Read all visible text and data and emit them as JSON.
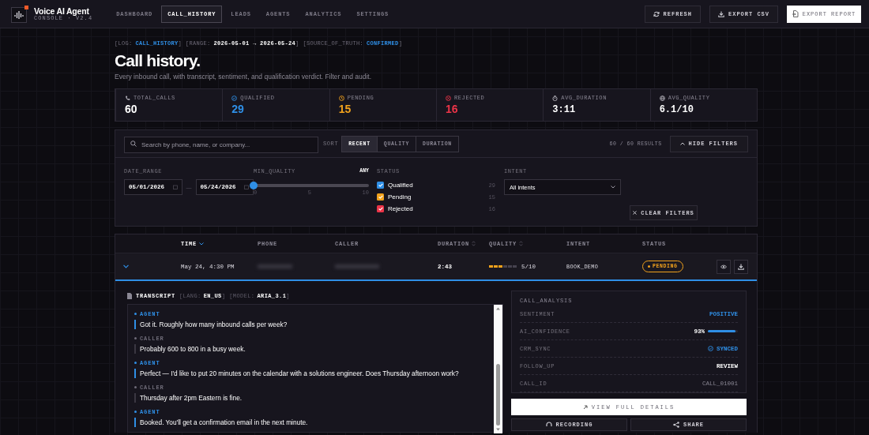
{
  "topbar": {
    "brand": "Voice AI Agent",
    "version": "CONSOLE · V2.4",
    "tabs": [
      {
        "label": "DASHBOARD",
        "selected": false
      },
      {
        "label": "CALL_HISTORY",
        "selected": true
      },
      {
        "label": "LEADS",
        "selected": false
      },
      {
        "label": "AGENTS",
        "selected": false
      },
      {
        "label": "ANALYTICS",
        "selected": false
      },
      {
        "label": "SETTINGS",
        "selected": false
      }
    ],
    "actions": [
      {
        "label": "REFRESH",
        "kind": "ghost"
      },
      {
        "label": "EXPORT CSV",
        "kind": "ghost"
      },
      {
        "label": "EXPORT REPORT",
        "kind": "primary"
      }
    ]
  },
  "header": {
    "meta": [
      {
        "open": "[LOG:",
        "value": "CALL_HISTORY",
        "close": "]",
        "kind": "accent"
      },
      {
        "open": "[RANGE:",
        "value": "2026-05-01 → 2026-05-24",
        "close": "]",
        "kind": "strong"
      },
      {
        "open": "[SOURCE_OF_TRUTH:",
        "value": "CONFIRMED",
        "close": "]",
        "kind": "accent"
      }
    ],
    "title": "Call history.",
    "subtitle": "Every inbound call, with transcript, sentiment, and qualification verdict. Filter and audit."
  },
  "stats": [
    {
      "label": "TOTAL_CALLS",
      "value": "60",
      "kind": "count",
      "color": "#ffffff"
    },
    {
      "label": "QUALIFIED",
      "value": "29",
      "kind": "count",
      "color": "#2f8fe6"
    },
    {
      "label": "PENDING",
      "value": "15",
      "kind": "count",
      "color": "#f2a21c"
    },
    {
      "label": "REJECTED",
      "value": "16",
      "kind": "count",
      "color": "#ec3448"
    },
    {
      "label": "AVG_DURATION",
      "value": "3:11",
      "kind": "metric",
      "color": "#ffffff"
    },
    {
      "label": "AVG_QUALITY",
      "value": "6.1/10",
      "kind": "metric",
      "color": "#ffffff"
    }
  ],
  "filters": {
    "search": {
      "placeholder": "Search by phone, name, or company..."
    },
    "sort_label": "SORT",
    "sort": [
      {
        "label": "RECENT",
        "selected": true
      },
      {
        "label": "QUALITY",
        "selected": false
      },
      {
        "label": "DURATION",
        "selected": false
      }
    ],
    "results": "60 / 60 RESULTS",
    "toggle": "HIDE FILTERS",
    "date_range": {
      "label": "DATE_RANGE",
      "from": "05/01/2026",
      "separator": "—",
      "to": "05/24/2026"
    },
    "min_quality": {
      "label": "MIN_QUALITY",
      "reading": "ANY",
      "level": 0,
      "ticks": [
        "0",
        "5",
        "10"
      ]
    },
    "status": {
      "label": "STATUS",
      "items": [
        {
          "label": "Qualified",
          "count": "29",
          "checked": true,
          "color": "#2f8fe6"
        },
        {
          "label": "Pending",
          "count": "15",
          "checked": true,
          "color": "#f2a21c"
        },
        {
          "label": "Rejected",
          "count": "16",
          "checked": true,
          "color": "#ec3448"
        }
      ]
    },
    "intent": {
      "label": "INTENT",
      "value": "All intents"
    },
    "clear": "CLEAR FILTERS"
  },
  "table": {
    "columns": [
      {
        "label": "TIME",
        "sorted": true
      },
      {
        "label": "PHONE",
        "sorted": false,
        "sortable": false
      },
      {
        "label": "CALLER",
        "sorted": false,
        "sortable": false
      },
      {
        "label": "DURATION",
        "sorted": false,
        "sortable": true
      },
      {
        "label": "QUALITY",
        "sorted": false,
        "sortable": true
      },
      {
        "label": "INTENT",
        "sorted": false,
        "sortable": false
      },
      {
        "label": "STATUS",
        "sorted": false,
        "sortable": false
      }
    ],
    "rows": [
      {
        "expanded": true,
        "time": "May 24, 4:30 PM",
        "redacted": true,
        "duration": "2:43",
        "quality": {
          "level": 0.5,
          "reading": "5/10"
        },
        "intent": "BOOK_DEMO",
        "status": {
          "label": "PENDING",
          "color": "#f2a21c"
        }
      }
    ]
  },
  "detail": {
    "transcript": {
      "title": "TRANSCRIPT",
      "meta": [
        {
          "open": "[LANG:",
          "value": "EN_US",
          "close": "]"
        },
        {
          "open": "[MODEL:",
          "value": "ARIA_3.1",
          "close": "]"
        }
      ],
      "messages": [
        {
          "speaker": "AGENT",
          "kind": "agent",
          "text": "Got it. Roughly how many inbound calls per week?"
        },
        {
          "speaker": "CALLER",
          "kind": "caller",
          "text": "Probably 600 to 800 in a busy week."
        },
        {
          "speaker": "AGENT",
          "kind": "agent",
          "text": "Perfect — I'd like to put 20 minutes on the calendar with a solutions engineer. Does Thursday afternoon work?"
        },
        {
          "speaker": "CALLER",
          "kind": "caller",
          "text": "Thursday after 2pm Eastern is fine."
        },
        {
          "speaker": "AGENT",
          "kind": "agent",
          "text": "Booked. You'll get a confirmation email in the next minute."
        }
      ]
    },
    "analysis": {
      "title": "CALL_ANALYSIS",
      "rows": [
        {
          "label": "SENTIMENT",
          "value": "POSITIVE",
          "kind": "accent"
        },
        {
          "label": "AI_CONFIDENCE",
          "value": "93%",
          "kind": "meter",
          "level": 0.93
        },
        {
          "label": "CRM_SYNC",
          "value": "SYNCED",
          "kind": "status"
        },
        {
          "label": "FOLLOW_UP",
          "value": "REVIEW",
          "kind": "strong"
        },
        {
          "label": "CALL_ID",
          "value": "CALL_01001",
          "kind": "muted"
        }
      ]
    },
    "actions": [
      {
        "label": "VIEW FULL DETAILS",
        "kind": "primary"
      },
      {
        "label": "RECORDING",
        "kind": "ghost"
      },
      {
        "label": "SHARE",
        "kind": "ghost"
      }
    ]
  }
}
